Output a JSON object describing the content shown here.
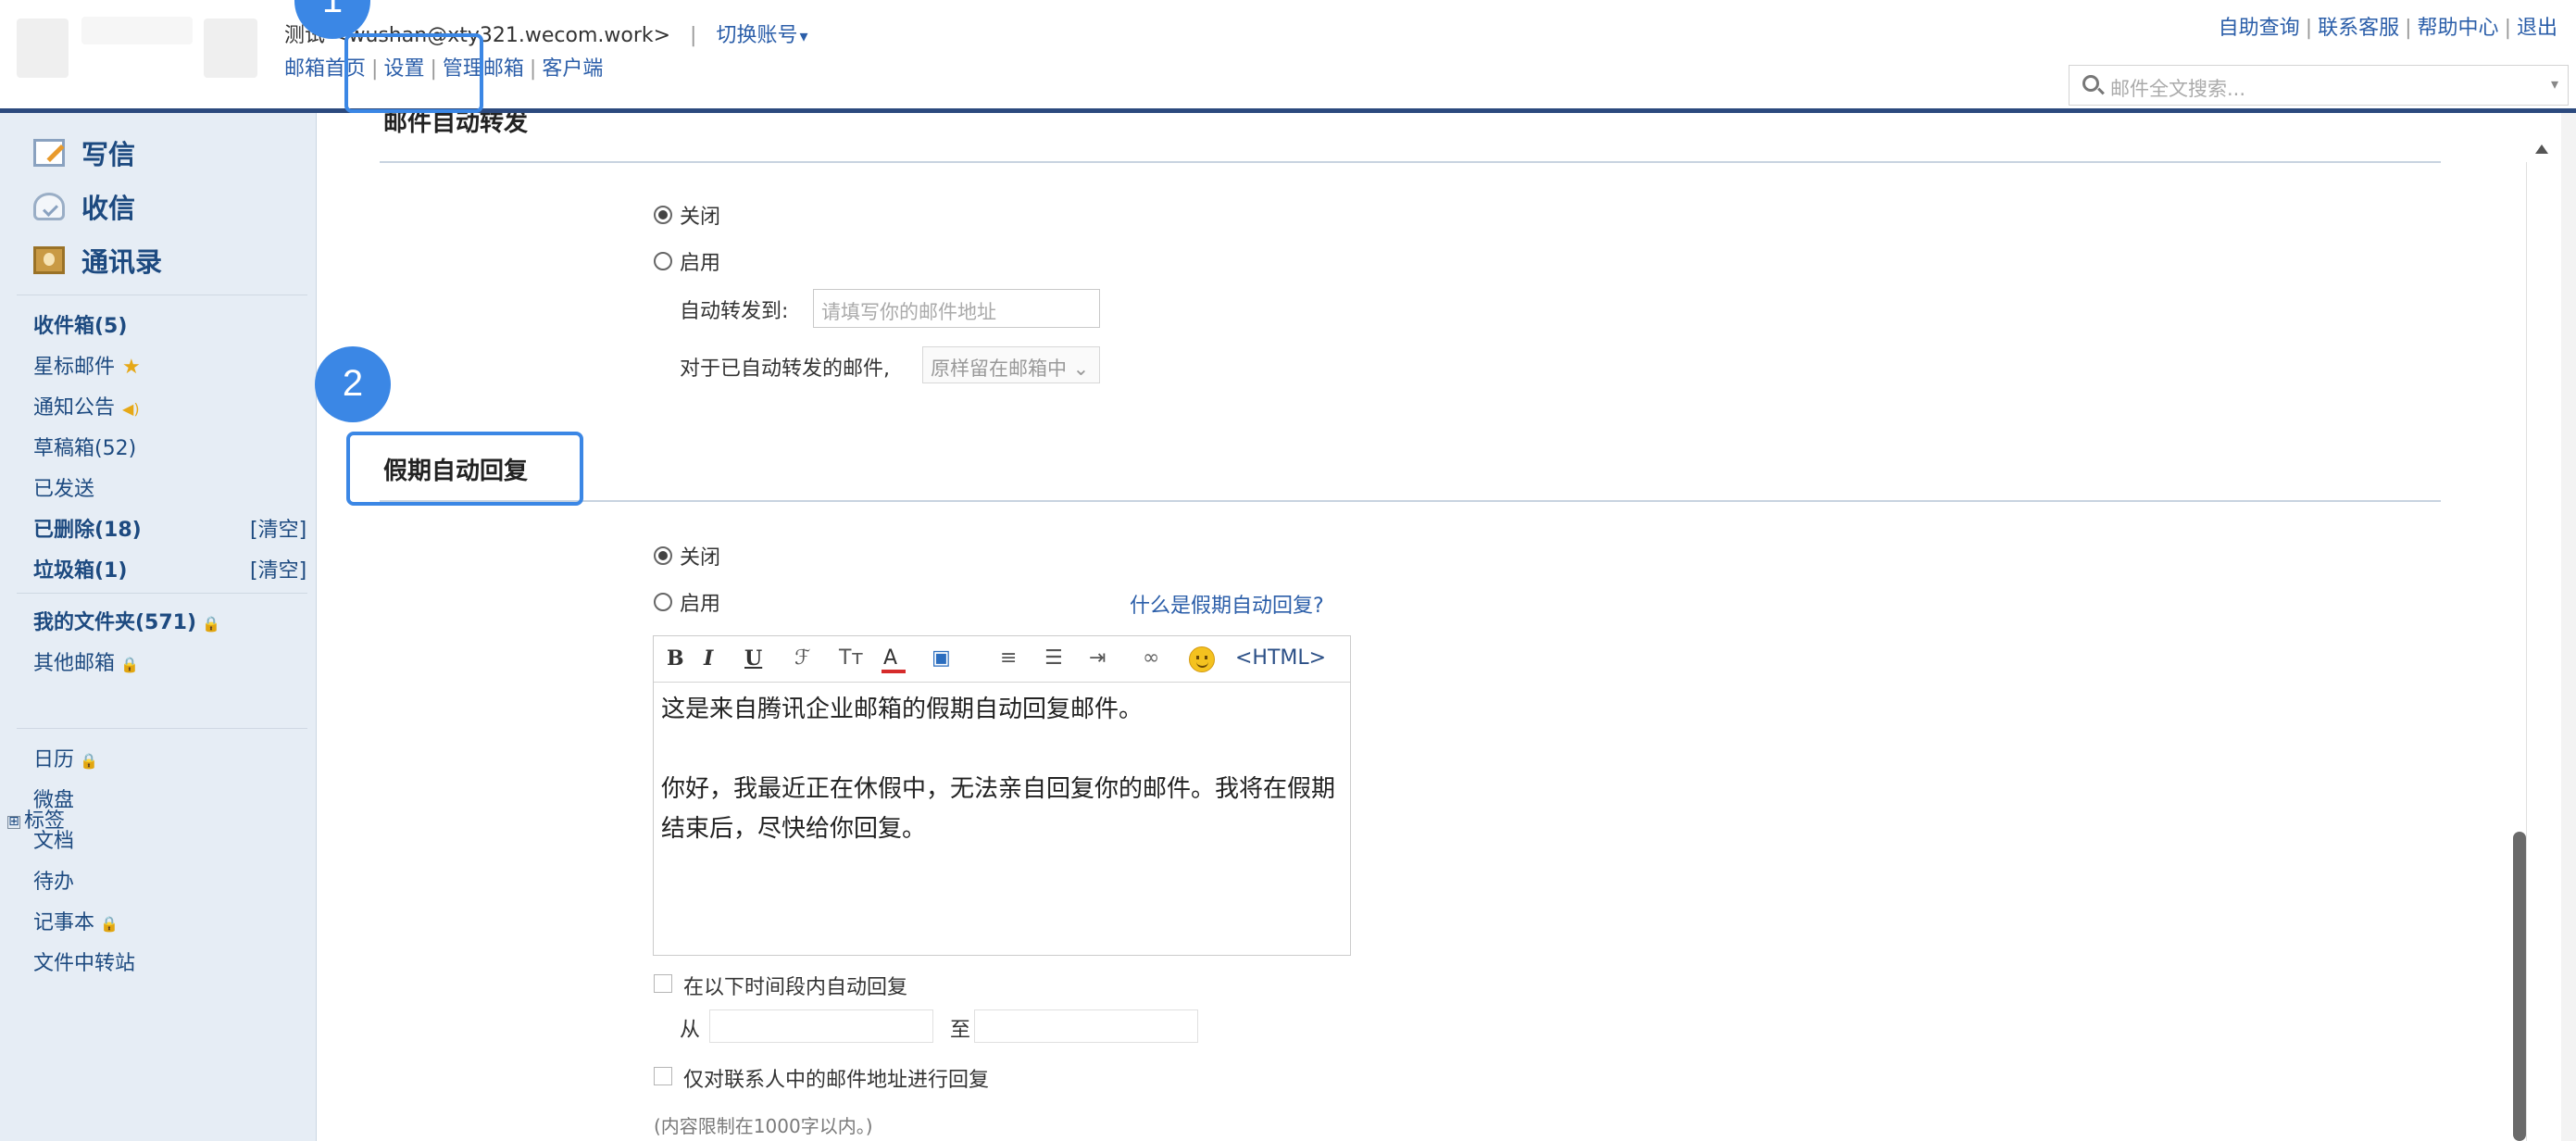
{
  "header": {
    "account_name": "测试",
    "account_email": "<wushan@xty321.wecom.work>",
    "separator": "|",
    "switch_account": "切换账号",
    "nav_links": [
      "邮箱首页",
      "设置",
      "管理邮箱",
      "客户端"
    ],
    "help_links": [
      "自助查询",
      "联系客服",
      "帮助中心",
      "退出"
    ],
    "search_placeholder": "邮件全文搜索..."
  },
  "sidebar": {
    "actions": [
      {
        "label": "写信",
        "icon": "write-icon"
      },
      {
        "label": "收信",
        "icon": "inbox-icon"
      },
      {
        "label": "通讯录",
        "icon": "contacts-icon"
      }
    ],
    "folders": [
      {
        "label": "收件箱(5)",
        "bold": true
      },
      {
        "label": "星标邮件",
        "extra": "★"
      },
      {
        "label": "通知公告",
        "extra": "◀)"
      },
      {
        "label": "草稿箱(52)"
      },
      {
        "label": "已发送"
      },
      {
        "label": "已删除(18)",
        "bold": true,
        "clear": "[清空]"
      },
      {
        "label": "垃圾箱(1)",
        "bold": true,
        "clear": "[清空]"
      }
    ],
    "my_folders": "我的文件夹(571)",
    "other_mailbox": "其他邮箱",
    "tags": "标签",
    "tags_toggle": "⊞",
    "tools": [
      "日历",
      "微盘",
      "文档",
      "待办",
      "记事本",
      "文件中转站"
    ]
  },
  "forward": {
    "title": "邮件自动转发",
    "off_label": "关闭",
    "on_label": "启用",
    "selected": "关闭",
    "forward_to_label": "自动转发到:",
    "forward_to_placeholder": "请填写你的邮件地址",
    "forwarded_label": "对于已自动转发的邮件,",
    "forwarded_option": "原样留在邮箱中"
  },
  "vacation": {
    "title": "假期自动回复",
    "off_label": "关闭",
    "on_label": "启用",
    "selected": "关闭",
    "what_is_link": "什么是假期自动回复?",
    "toolbar": {
      "bold": "B",
      "italic": "I",
      "underline": "U",
      "html": "<HTML>"
    },
    "body_line1": "这是来自腾讯企业邮箱的假期自动回复邮件。",
    "body_line2": "你好，我最近正在休假中，无法亲自回复你的邮件。我将在假期结束后，尽快给你回复。",
    "time_range_label": "在以下时间段内自动回复",
    "from_label": "从",
    "to_label": "至",
    "contacts_only_label": "仅对联系人中的邮件地址进行回复",
    "limit_note": "(内容限制在1000字以内。)"
  },
  "annotations": {
    "step1": "1",
    "step2": "2",
    "color": "#3b87e5"
  }
}
